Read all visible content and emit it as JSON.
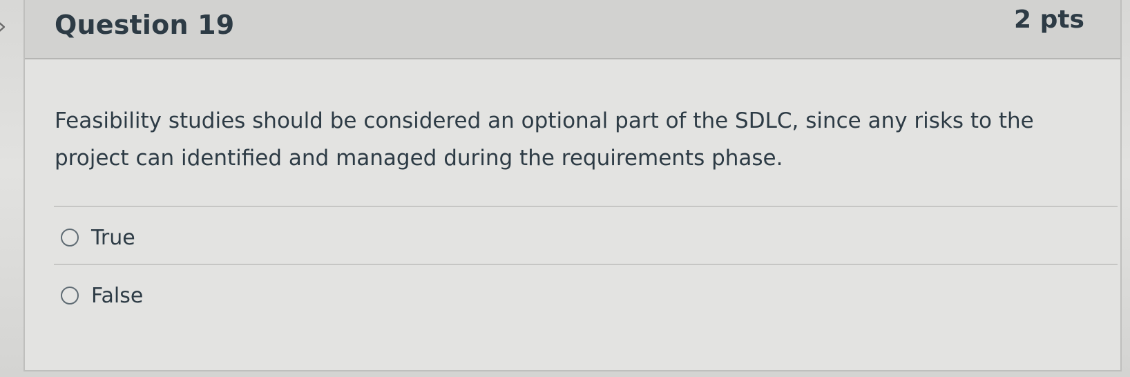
{
  "question": {
    "title": "Question 19",
    "points": "2 pts",
    "text": "Feasibility studies should be considered an optional part of the SDLC, since any risks to the project can identified and managed during the requirements phase.",
    "answers": [
      {
        "label": "True",
        "selected": false
      },
      {
        "label": "False",
        "selected": false
      }
    ]
  },
  "icons": {
    "previous": "chevron-right-icon"
  }
}
